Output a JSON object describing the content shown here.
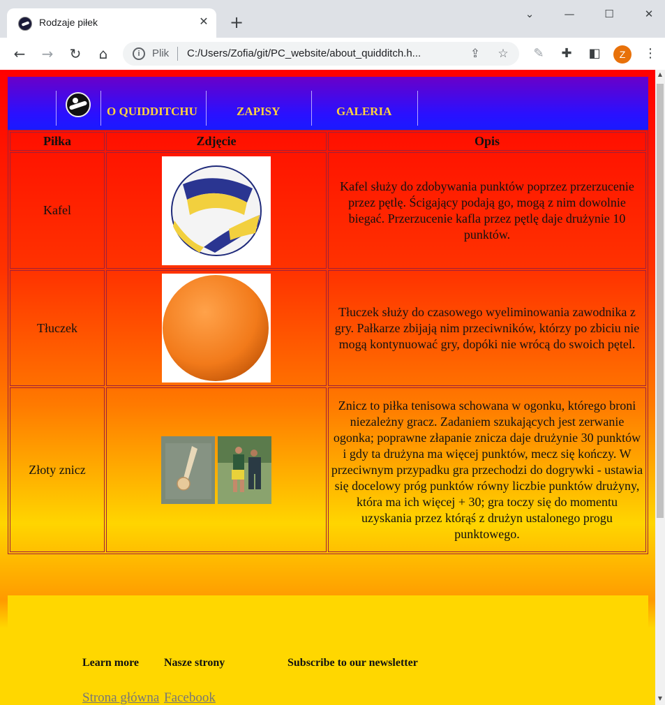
{
  "browser": {
    "tab_title": "Rodzaje piłek",
    "omnibox_prefix": "Plik",
    "url": "C:/Users/Zofia/git/PC_website/about_quidditch.h...",
    "avatar_letter": "Z"
  },
  "nav": {
    "items": [
      "O QUIDDITCHU",
      "ZAPISY",
      "GALERIA"
    ],
    "link_color": "#ffd33d"
  },
  "table": {
    "headers": [
      "Piłka",
      "Zdjęcie",
      "Opis"
    ],
    "rows": [
      {
        "name": "Kafel",
        "image": "volleyball-image",
        "description": "Kafel służy do zdobywania punktów poprzez przerzucenie przez pętlę. Ścigający podają go, mogą z nim dowolnie biegać. Przerzucenie kafla przez pętlę daje drużynie 10 punktów."
      },
      {
        "name": "Tłuczek",
        "image": "orange-ball-image",
        "description": "Tłuczek służy do czasowego wyeliminowania zawodnika z gry. Pałkarze zbijają nim przeciwników, którzy po zbiciu nie mogą kontynuować gry, dopóki nie wrócą do swoich pętel."
      },
      {
        "name": "Złoty znicz",
        "image": "snitch-photos",
        "description": "Znicz to piłka tenisowa schowana w ogonku, którego broni niezależny gracz. Zadaniem szukających jest zerwanie ogonka; poprawne złapanie znicza daje drużynie 30 punktów i gdy ta drużyna ma więcej punktów, mecz się kończy. W przeciwnym przypadku gra przechodzi do dogrywki - ustawia się docelowy próg punktów równy liczbie punktów drużyny, która ma ich więcej + 30; gra toczy się do momentu uzyskania przez którąś z drużyn ustalonego progu punktowego."
      }
    ]
  },
  "footer": {
    "headings": [
      "Learn more",
      "Nasze strony",
      "Subscribe to our newsletter"
    ],
    "links": [
      "Strona główna",
      "Facebook"
    ]
  },
  "colors": {
    "nav_gradient": [
      "#6a00c8",
      "#1a1aff"
    ],
    "page_gradient": [
      "#ff0000",
      "#ff7a00",
      "#ffd500"
    ],
    "table_border": "#a0203a",
    "footer_bg": "#ffd700"
  }
}
